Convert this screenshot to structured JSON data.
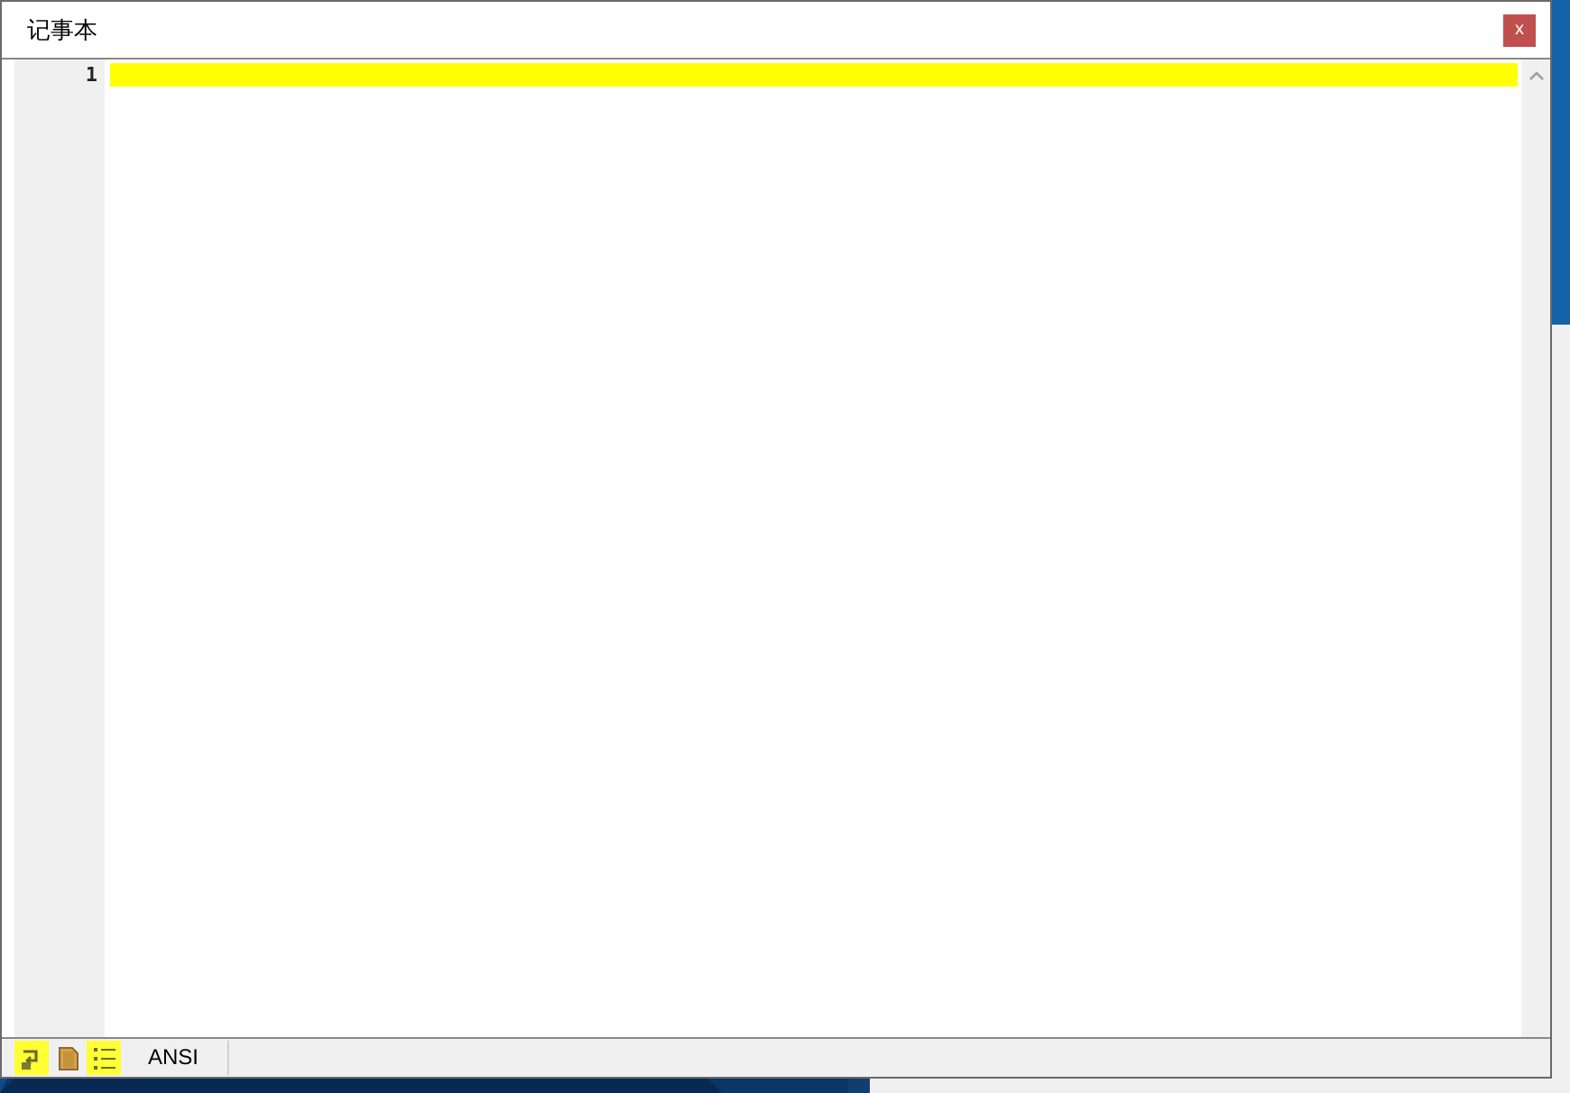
{
  "window": {
    "title": "记事本",
    "close_label": "x"
  },
  "editor": {
    "lines": [
      {
        "number": "1",
        "current": true
      }
    ]
  },
  "status_bar": {
    "buttons": [
      {
        "kind": "wrap",
        "on": true
      },
      {
        "kind": "file",
        "on": false
      },
      {
        "kind": "list",
        "on": true
      }
    ],
    "encoding": "ANSI"
  }
}
